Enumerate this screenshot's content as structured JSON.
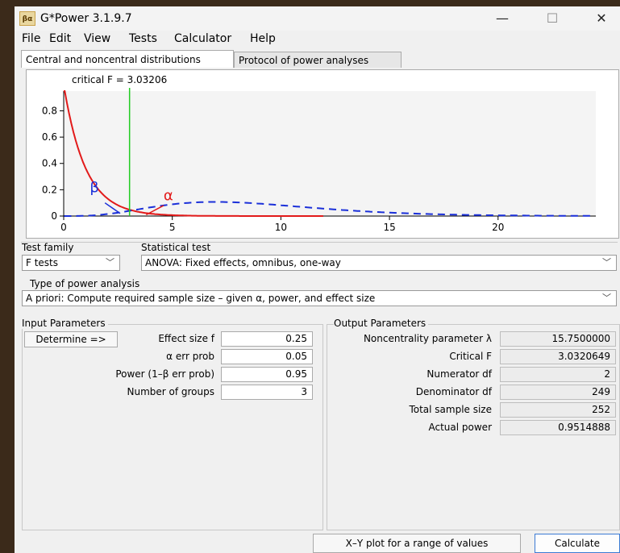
{
  "window": {
    "title": "G*Power 3.1.9.7",
    "icon_text": "βα"
  },
  "title_buttons": {
    "minimize": "—",
    "maximize": "☐",
    "close": "✕"
  },
  "menu": [
    "File",
    "Edit",
    "View",
    "Tests",
    "Calculator",
    "Help"
  ],
  "tabs": [
    "Central and noncentral distributions",
    "Protocol of power analyses"
  ],
  "chart_data": {
    "type": "line",
    "annotation": "critical F = 3.03206",
    "critical_F": 3.03206,
    "xlim": [
      0,
      24.5
    ],
    "ylim": [
      0,
      0.95
    ],
    "x_ticks": [
      0,
      5,
      10,
      15,
      20
    ],
    "x_tick_labels": [
      "0",
      "5",
      "10",
      "15",
      "20"
    ],
    "y_ticks": [
      0,
      0.2,
      0.4,
      0.6,
      0.8
    ],
    "y_tick_labels": [
      "0",
      "0.2",
      "0.4",
      "0.6",
      "0.8"
    ],
    "df1": 2,
    "df2": 249,
    "lambda": 15.75,
    "series": [
      {
        "style": "central F density, red solid",
        "color": "#e21a1a"
      },
      {
        "style": "noncentral F density, blue dashed",
        "color": "#1a2fd9"
      }
    ],
    "labels": {
      "beta": "β",
      "alpha": "α"
    },
    "grid": false
  },
  "test_family": {
    "label": "Test family",
    "value": "F tests"
  },
  "statistical_test": {
    "label": "Statistical test",
    "value": "ANOVA: Fixed effects, omnibus, one-way"
  },
  "power_analysis": {
    "label": "Type of power analysis",
    "value": "A priori: Compute required sample size – given α, power, and effect size"
  },
  "input": {
    "title": "Input Parameters",
    "determine_label": "Determine =>",
    "rows": [
      {
        "label": "Effect size f",
        "value": "0.25"
      },
      {
        "label": "α err prob",
        "value": "0.05"
      },
      {
        "label": "Power (1–β err prob)",
        "value": "0.95"
      },
      {
        "label": "Number of groups",
        "value": "3"
      }
    ]
  },
  "output": {
    "title": "Output Parameters",
    "rows": [
      {
        "label": "Noncentrality parameter λ",
        "value": "15.7500000"
      },
      {
        "label": "Critical F",
        "value": "3.0320649"
      },
      {
        "label": "Numerator df",
        "value": "2"
      },
      {
        "label": "Denominator df",
        "value": "249"
      },
      {
        "label": "Total sample size",
        "value": "252"
      },
      {
        "label": "Actual power",
        "value": "0.9514888"
      }
    ]
  },
  "buttons": {
    "xy_plot": "X–Y plot for a range of values",
    "calculate": "Calculate"
  },
  "colors": {
    "central": "#e21a1a",
    "noncentral": "#1a2fd9",
    "critical_line": "#22cc22"
  }
}
